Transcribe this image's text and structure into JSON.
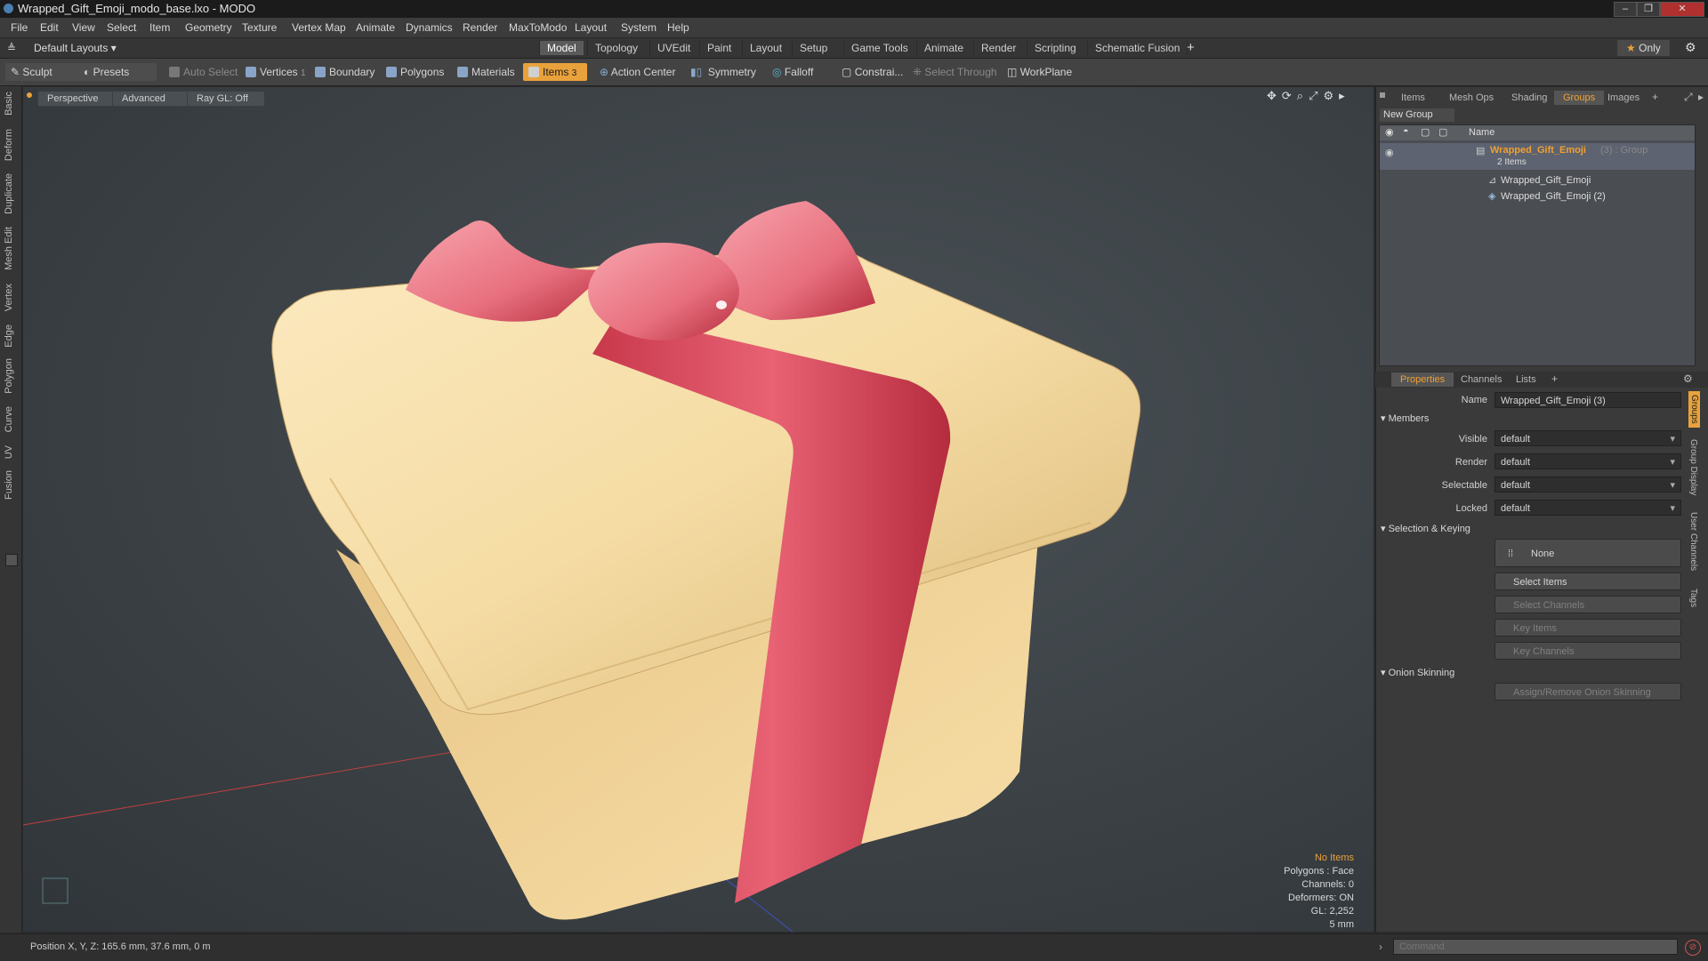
{
  "window": {
    "title": "Wrapped_Gift_Emoji_modo_base.lxo - MODO"
  },
  "menu": [
    "File",
    "Edit",
    "View",
    "Select",
    "Item",
    "Geometry",
    "Texture",
    "Vertex Map",
    "Animate",
    "Dynamics",
    "Render",
    "MaxToModo",
    "Layout",
    "System",
    "Help"
  ],
  "layouts": {
    "dropdown": "Default Layouts",
    "tabs": [
      "Model",
      "Topology",
      "UVEdit",
      "Paint",
      "Layout",
      "Setup",
      "Game Tools",
      "Animate",
      "Render",
      "Scripting",
      "Schematic Fusion"
    ],
    "active": "Model",
    "only_label": "Only"
  },
  "toolbar": {
    "sculpt": "Sculpt",
    "presets": "Presets",
    "auto_select": "Auto Select",
    "vertices": "Vertices",
    "vertices_count": "1",
    "boundary": "Boundary",
    "polygons": "Polygons",
    "materials": "Materials",
    "items": "Items",
    "items_count": "3",
    "action_center": "Action Center",
    "symmetry": "Symmetry",
    "falloff": "Falloff",
    "constraints": "Constrai...",
    "select_through": "Select Through",
    "workplane": "WorkPlane"
  },
  "left_tabs": [
    "Basic",
    "Deform",
    "Duplicate",
    "Mesh Edit",
    "Vertex",
    "Edge",
    "Polygon",
    "Curve",
    "UV",
    "Fusion"
  ],
  "viewport": {
    "view_mode": "Perspective",
    "shading": "Advanced",
    "raygl": "Ray GL: Off",
    "info": {
      "no_items": "No Items",
      "polygons": "Polygons : Face",
      "channels": "Channels: 0",
      "deformers": "Deformers: ON",
      "gl": "GL: 2,252",
      "scale": "5 mm"
    }
  },
  "right_tabs": [
    "Items",
    "Mesh Ops",
    "Shading",
    "Groups",
    "Images"
  ],
  "right_active": "Groups",
  "groups": {
    "new_group": "New Group",
    "name_header": "Name",
    "group_name": "Wrapped_Gift_Emoji",
    "group_suffix": "(3) : Group",
    "items_count": "2 Items",
    "members": [
      "Wrapped_Gift_Emoji",
      "Wrapped_Gift_Emoji (2)"
    ]
  },
  "properties": {
    "tabs": [
      "Properties",
      "Channels",
      "Lists"
    ],
    "active": "Properties",
    "name_label": "Name",
    "name_value": "Wrapped_Gift_Emoji (3)",
    "members_section": "Members",
    "visible_label": "Visible",
    "visible_value": "default",
    "render_label": "Render",
    "render_value": "default",
    "selectable_label": "Selectable",
    "selectable_value": "default",
    "locked_label": "Locked",
    "locked_value": "default",
    "selection_section": "Selection & Keying",
    "none_btn": "None",
    "select_items": "Select Items",
    "select_channels": "Select Channels",
    "key_items": "Key Items",
    "key_channels": "Key Channels",
    "onion_section": "Onion Skinning",
    "onion_btn": "Assign/Remove Onion Skinning",
    "side_tabs": [
      "Groups",
      "Group Display",
      "User Channels",
      "Tags"
    ]
  },
  "status": {
    "position": "Position X, Y, Z:  165.6 mm, 37.6 mm, 0 m",
    "command_placeholder": "Command"
  },
  "colors": {
    "accent": "#e9a23b",
    "box": "#f1d9a0",
    "ribbon": "#e0566a"
  }
}
